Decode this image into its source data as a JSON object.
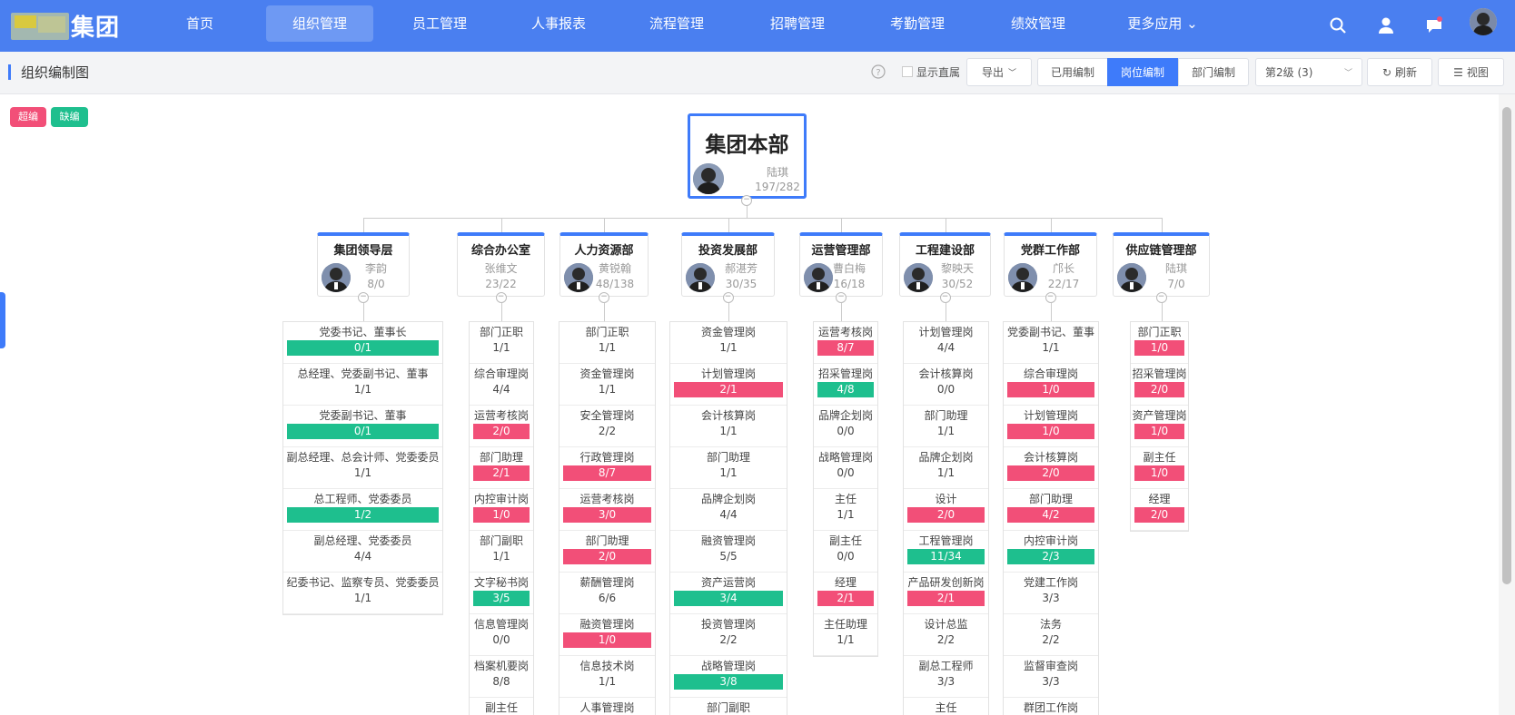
{
  "brand": {
    "logo_text": "集团"
  },
  "nav": [
    "首页",
    "组织管理",
    "员工管理",
    "人事报表",
    "流程管理",
    "招聘管理",
    "考勤管理",
    "绩效管理",
    "更多应用"
  ],
  "nav_active": 1,
  "subbar": {
    "title": "组织编制图",
    "show_direct": "显示直属",
    "export": "导出",
    "used": "已用编制",
    "post": "岗位编制",
    "dept": "部门编制",
    "level": "第2级 (3)",
    "refresh": "刷新",
    "view": "视图"
  },
  "legend": {
    "over": "超编",
    "short": "缺编"
  },
  "colors": {
    "primary": "#4a7ff0",
    "over": "#f24f78",
    "short": "#1ebf8e"
  },
  "root": {
    "name": "集团本部",
    "manager": "陆琪",
    "count": "197/282"
  },
  "depts": [
    {
      "name": "集团领导层",
      "manager": "李韵",
      "count": "8/0",
      "avatar": true,
      "posts": [
        [
          "党委书记、董事长",
          "0/1",
          "green"
        ],
        [
          "总经理、党委副书记、董事",
          "1/1",
          ""
        ],
        [
          "党委副书记、董事",
          "0/1",
          "green"
        ],
        [
          "副总经理、总会计师、党委委员",
          "1/1",
          ""
        ],
        [
          "总工程师、党委委员",
          "1/2",
          "green"
        ],
        [
          "副总经理、党委委员",
          "4/4",
          ""
        ],
        [
          "纪委书记、监察专员、党委委员",
          "1/1",
          ""
        ]
      ]
    },
    {
      "name": "综合办公室",
      "manager": "张维文",
      "count": "23/22",
      "avatar": false,
      "posts": [
        [
          "部门正职",
          "1/1",
          ""
        ],
        [
          "综合审理岗",
          "4/4",
          ""
        ],
        [
          "运营考核岗",
          "2/0",
          "red"
        ],
        [
          "部门助理",
          "2/1",
          "red"
        ],
        [
          "内控审计岗",
          "1/0",
          "red"
        ],
        [
          "部门副职",
          "1/1",
          ""
        ],
        [
          "文字秘书岗",
          "3/5",
          "green"
        ],
        [
          "信息管理岗",
          "0/0",
          ""
        ],
        [
          "档案机要岗",
          "8/8",
          ""
        ],
        [
          "副主任",
          "",
          ""
        ]
      ]
    },
    {
      "name": "人力资源部",
      "manager": "黄锐翰",
      "count": "48/138",
      "avatar": true,
      "posts": [
        [
          "部门正职",
          "1/1",
          ""
        ],
        [
          "资金管理岗",
          "1/1",
          ""
        ],
        [
          "安全管理岗",
          "2/2",
          ""
        ],
        [
          "行政管理岗",
          "8/7",
          "red"
        ],
        [
          "运营考核岗",
          "3/0",
          "red"
        ],
        [
          "部门助理",
          "2/0",
          "red"
        ],
        [
          "薪酬管理岗",
          "6/6",
          ""
        ],
        [
          "融资管理岗",
          "1/0",
          "red"
        ],
        [
          "信息技术岗",
          "1/1",
          ""
        ],
        [
          "人事管理岗",
          "",
          ""
        ]
      ]
    },
    {
      "name": "投资发展部",
      "manager": "郝湛芳",
      "count": "30/35",
      "avatar": true,
      "posts": [
        [
          "资金管理岗",
          "1/1",
          ""
        ],
        [
          "计划管理岗",
          "2/1",
          "red"
        ],
        [
          "会计核算岗",
          "1/1",
          ""
        ],
        [
          "部门助理",
          "1/1",
          ""
        ],
        [
          "品牌企划岗",
          "4/4",
          ""
        ],
        [
          "融资管理岗",
          "5/5",
          ""
        ],
        [
          "资产运营岗",
          "3/4",
          "green"
        ],
        [
          "投资管理岗",
          "2/2",
          ""
        ],
        [
          "战略管理岗",
          "3/8",
          "green"
        ],
        [
          "部门副职",
          "",
          ""
        ]
      ]
    },
    {
      "name": "运营管理部",
      "manager": "曹白梅",
      "count": "16/18",
      "avatar": true,
      "posts": [
        [
          "运营考核岗",
          "8/7",
          "red"
        ],
        [
          "招采管理岗",
          "4/8",
          "green"
        ],
        [
          "品牌企划岗",
          "0/0",
          ""
        ],
        [
          "战略管理岗",
          "0/0",
          ""
        ],
        [
          "主任",
          "1/1",
          ""
        ],
        [
          "副主任",
          "0/0",
          ""
        ],
        [
          "经理",
          "2/1",
          "red"
        ],
        [
          "主任助理",
          "1/1",
          ""
        ]
      ]
    },
    {
      "name": "工程建设部",
      "manager": "黎映天",
      "count": "30/52",
      "avatar": true,
      "posts": [
        [
          "计划管理岗",
          "4/4",
          ""
        ],
        [
          "会计核算岗",
          "0/0",
          ""
        ],
        [
          "部门助理",
          "1/1",
          ""
        ],
        [
          "品牌企划岗",
          "1/1",
          ""
        ],
        [
          "设计",
          "2/0",
          "red"
        ],
        [
          "工程管理岗",
          "11/34",
          "green"
        ],
        [
          "产品研发创新岗",
          "2/1",
          "red"
        ],
        [
          "设计总监",
          "2/2",
          ""
        ],
        [
          "副总工程师",
          "3/3",
          ""
        ],
        [
          "主任",
          "",
          ""
        ]
      ]
    },
    {
      "name": "党群工作部",
      "manager": "邝长",
      "count": "22/17",
      "avatar": true,
      "posts": [
        [
          "党委副书记、董事",
          "1/1",
          ""
        ],
        [
          "综合审理岗",
          "1/0",
          "red"
        ],
        [
          "计划管理岗",
          "1/0",
          "red"
        ],
        [
          "会计核算岗",
          "2/0",
          "red"
        ],
        [
          "部门助理",
          "4/2",
          "red"
        ],
        [
          "内控审计岗",
          "2/3",
          "green"
        ],
        [
          "党建工作岗",
          "3/3",
          ""
        ],
        [
          "法务",
          "2/2",
          ""
        ],
        [
          "监督审查岗",
          "3/3",
          ""
        ],
        [
          "群团工作岗",
          "",
          ""
        ]
      ]
    },
    {
      "name": "供应链管理部",
      "manager": "陆琪",
      "count": "7/0",
      "avatar": true,
      "posts": [
        [
          "部门正职",
          "1/0",
          "red"
        ],
        [
          "招采管理岗",
          "2/0",
          "red"
        ],
        [
          "资产管理岗",
          "1/0",
          "red"
        ],
        [
          "副主任",
          "1/0",
          "red"
        ],
        [
          "经理",
          "2/0",
          "red"
        ]
      ]
    }
  ]
}
